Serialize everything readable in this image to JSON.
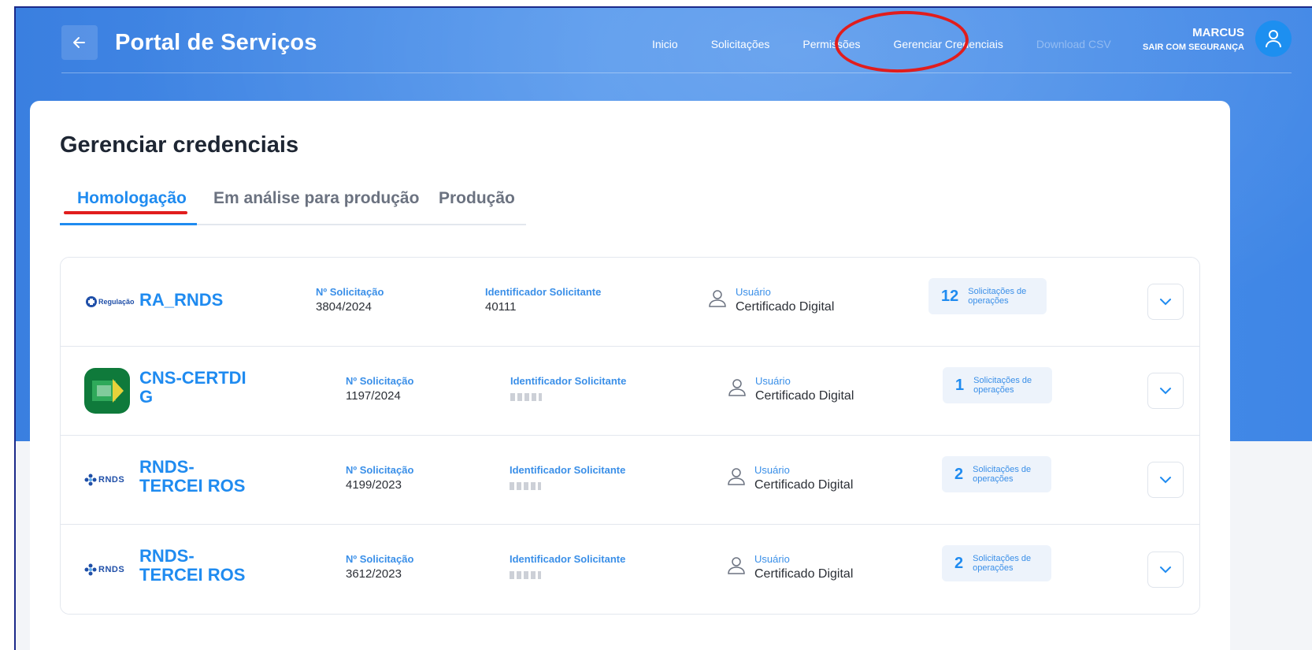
{
  "header": {
    "title": "Portal de Serviços",
    "nav": [
      "Inicio",
      "Solicitações",
      "Permissões",
      "Gerenciar Credenciais",
      "Download CSV"
    ],
    "user_name": "MARCUS",
    "logout_label": "SAIR COM SEGURANÇA"
  },
  "page": {
    "title": "Gerenciar credenciais",
    "tabs": [
      "Homologação",
      "Em análise para produção",
      "Produção"
    ]
  },
  "labels": {
    "request_no": "Nº Solicitação",
    "requester_id": "Identificador Solicitante",
    "user": "Usuário",
    "ops": "Solicitações de operações"
  },
  "rows": [
    {
      "name": "RA_RNDS",
      "request_no": "3804/2024",
      "requester_id": "40111",
      "user": "Certificado Digital",
      "ops_count": "12",
      "logo": "sus-regulacao-logo",
      "logo_text": "Regulação"
    },
    {
      "name": "CNS-CERTDI G",
      "request_no": "1197/2024",
      "requester_id": "",
      "user": "Certificado Digital",
      "ops_count": "1",
      "logo": "cns-app-logo"
    },
    {
      "name": "RNDS-TERCEI ROS",
      "request_no": "4199/2023",
      "requester_id": "",
      "user": "Certificado Digital",
      "ops_count": "2",
      "logo": "rnds-logo",
      "logo_text": "RNDS"
    },
    {
      "name": "RNDS-TERCEI ROS",
      "request_no": "3612/2023",
      "requester_id": "",
      "user": "Certificado Digital",
      "ops_count": "2",
      "logo": "rnds-logo",
      "logo_text": "RNDS"
    }
  ],
  "colors": {
    "primary": "#1f8bf0",
    "header": "#3f86e6",
    "annotation": "#e11d1d"
  }
}
